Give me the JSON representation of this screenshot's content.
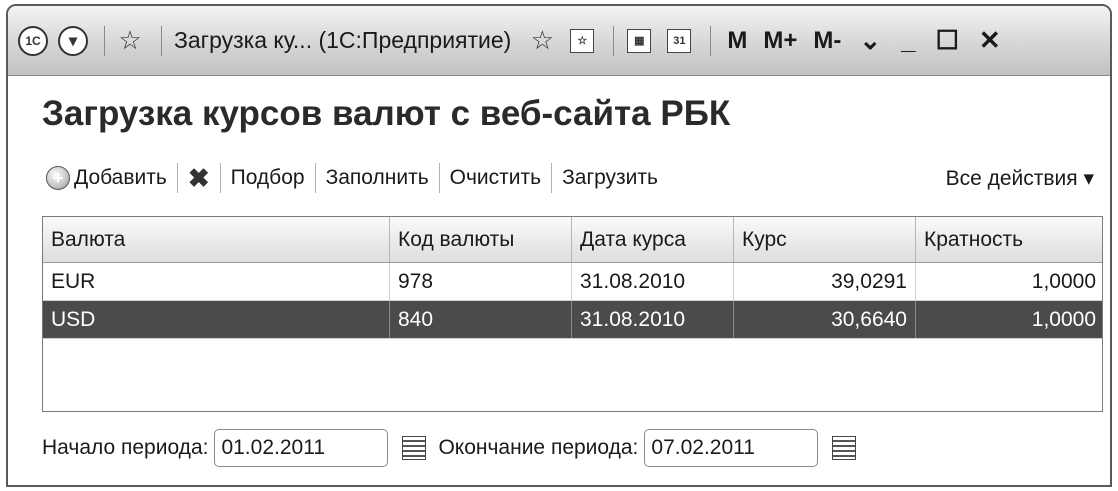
{
  "titlebar": {
    "logo": "1С",
    "title": "Загрузка ку...  (1С:Предприятие)",
    "icons": [
      "1c-logo-icon",
      "nav-down-icon",
      "star-icon",
      "star-favorite-icon",
      "link-icon",
      "calculator-icon",
      "calendar-icon"
    ],
    "calendar_label": "31",
    "m": "M",
    "m_plus": "M+",
    "m_minus": "M-",
    "minimize": "_",
    "maximize": "☐",
    "close": "✕"
  },
  "heading": "Загрузка курсов валют с веб-сайта РБК",
  "toolbar": {
    "add": "Добавить",
    "pick": "Подбор",
    "fill": "Заполнить",
    "clear": "Очистить",
    "load": "Загрузить",
    "all_actions": "Все действия ▾"
  },
  "table": {
    "columns": [
      "Валюта",
      "Код валюты",
      "Дата курса",
      "Курс",
      "Кратность"
    ],
    "rows": [
      {
        "currency": "EUR",
        "code": "978",
        "date": "31.08.2010",
        "rate": "39,0291",
        "multiplicity": "1,0000",
        "selected": false
      },
      {
        "currency": "USD",
        "code": "840",
        "date": "31.08.2010",
        "rate": "30,6640",
        "multiplicity": "1,0000",
        "selected": true
      }
    ]
  },
  "period": {
    "start_label": "Начало периода:",
    "start_value": "01.02.2011",
    "end_label": "Окончание периода:",
    "end_value": "07.02.2011"
  },
  "colors": {
    "selected_row_bg": "#4b4b4b",
    "titlebar_bg": "#d6d6d6"
  }
}
